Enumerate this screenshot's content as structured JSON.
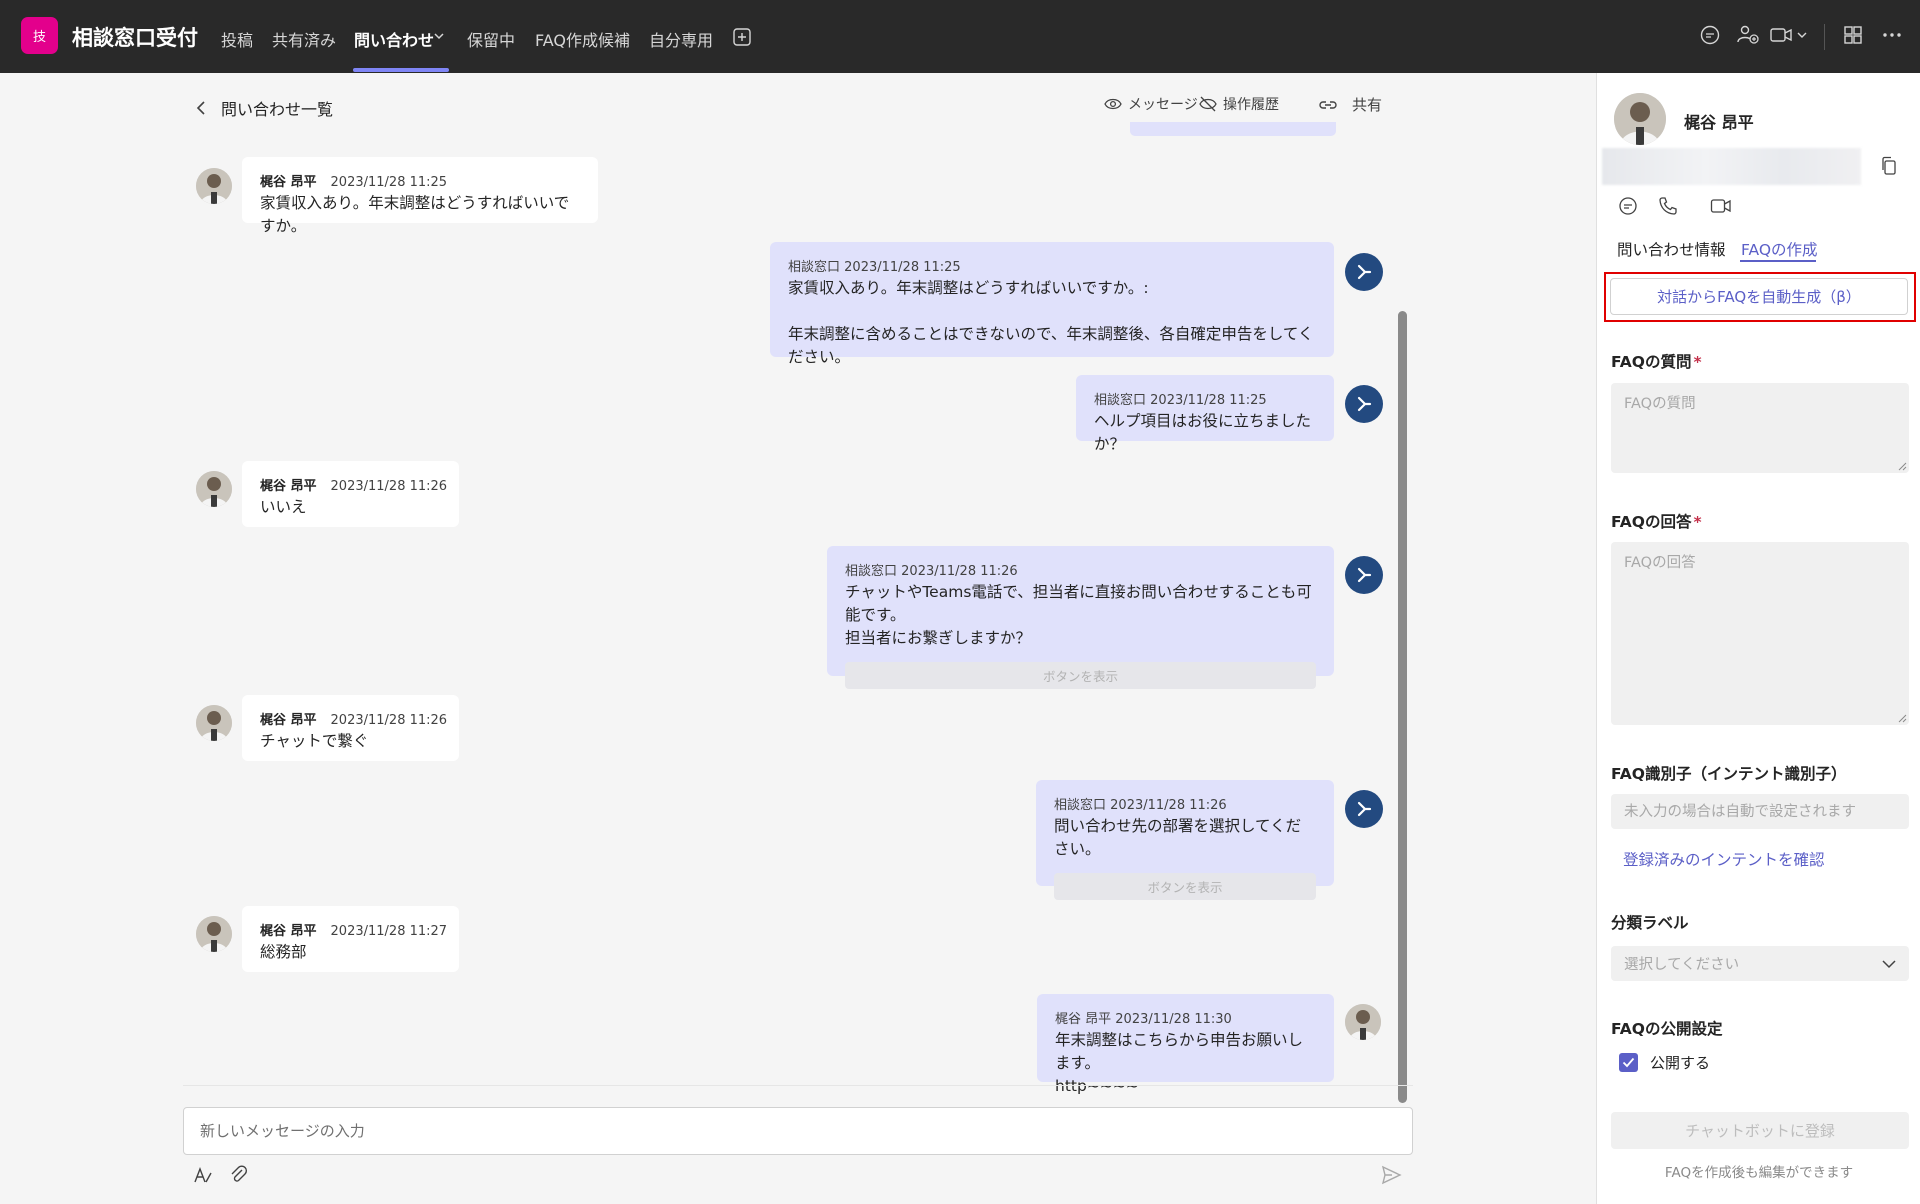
{
  "app": {
    "badge": "技",
    "title": "相談窓口受付"
  },
  "tabs": [
    {
      "label": "投稿"
    },
    {
      "label": "共有済み"
    },
    {
      "label": "問い合わせ"
    },
    {
      "label": "保留中"
    },
    {
      "label": "FAQ作成候補"
    },
    {
      "label": "自分専用"
    }
  ],
  "header": {
    "back_label": "問い合わせ一覧",
    "message_label": "メッセージ",
    "history_label": "操作履歴",
    "share_label": "共有"
  },
  "messages": [
    {
      "sender": "梶谷 昂平",
      "time": "2023/11/28 11:25",
      "text": "家賃収入あり。年末調整はどうすればいいですか。"
    },
    {
      "sender": "相談窓口",
      "time": "2023/11/28 11:25",
      "text": "家賃収入あり。年末調整はどうすればいいですか。:\n\n年末調整に含めることはできないので、年末調整後、各自確定申告をしてください。"
    },
    {
      "sender": "相談窓口",
      "time": "2023/11/28 11:25",
      "text": "ヘルプ項目はお役に立ちましたか？"
    },
    {
      "sender": "梶谷 昂平",
      "time": "2023/11/28 11:26",
      "text": "いいえ"
    },
    {
      "sender": "相談窓口",
      "time": "2023/11/28 11:26",
      "text": "チャットやTeams電話で、担当者に直接お問い合わせすることも可能です。\n担当者にお繋ぎしますか？",
      "button": "ボタンを表示"
    },
    {
      "sender": "梶谷 昂平",
      "time": "2023/11/28 11:26",
      "text": "チャットで繋ぐ"
    },
    {
      "sender": "相談窓口",
      "time": "2023/11/28 11:26",
      "text": "問い合わせ先の部署を選択してください。",
      "button": "ボタンを表示"
    },
    {
      "sender": "梶谷 昂平",
      "time": "2023/11/28 11:27",
      "text": "総務部"
    },
    {
      "sender": "梶谷 昂平",
      "time": "2023/11/28 11:30",
      "text": "年末調整はこちらから申告お願いします。\nhttp~~~~"
    }
  ],
  "composer": {
    "placeholder": "新しいメッセージの入力"
  },
  "side": {
    "name": "梶谷 昂平",
    "tabs": [
      {
        "label": "問い合わせ情報"
      },
      {
        "label": "FAQの作成"
      }
    ],
    "autogen_label": "対話からFAQを自動生成（β）",
    "question_label": "FAQの質問",
    "question_placeholder": "FAQの質問",
    "answer_label": "FAQの回答",
    "answer_placeholder": "FAQの回答",
    "intent_label": "FAQ識別子（インテント識別子）",
    "intent_placeholder": "未入力の場合は自動で設定されます",
    "intent_link": "登録済みのインテントを確認",
    "category_label": "分類ラベル",
    "category_placeholder": "選択してください",
    "publish_label": "FAQの公開設定",
    "publish_check_label": "公開する",
    "publish_checked": true,
    "register_label": "チャットボットに登録",
    "footnote": "FAQを作成後も編集ができます",
    "required_mark": "*"
  },
  "colors": {
    "accent": "#5b5fc7",
    "topbar": "#292929",
    "badge": "#e3008c",
    "bot": "#234a80",
    "highlight": "#e00000"
  }
}
